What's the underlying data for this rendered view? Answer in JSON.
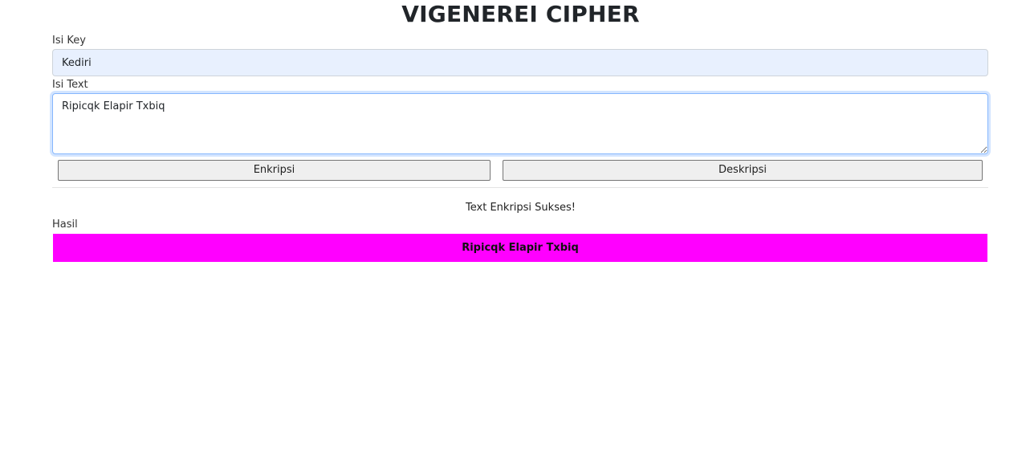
{
  "page": {
    "title": "VIGENEREI CIPHER"
  },
  "form": {
    "key_label": "Isi Key",
    "key_value": "Kediri",
    "text_label": "Isi Text",
    "text_value": "Ripicqk Elapir Txbiq"
  },
  "buttons": {
    "encrypt_label": "Enkripsi",
    "decrypt_label": "Deskripsi"
  },
  "output": {
    "status_text": "Text Enkripsi Sukses!",
    "result_label": "Hasil",
    "result_value": "Ripicqk Elapir Txbiq",
    "result_background": "#ff00ff"
  }
}
